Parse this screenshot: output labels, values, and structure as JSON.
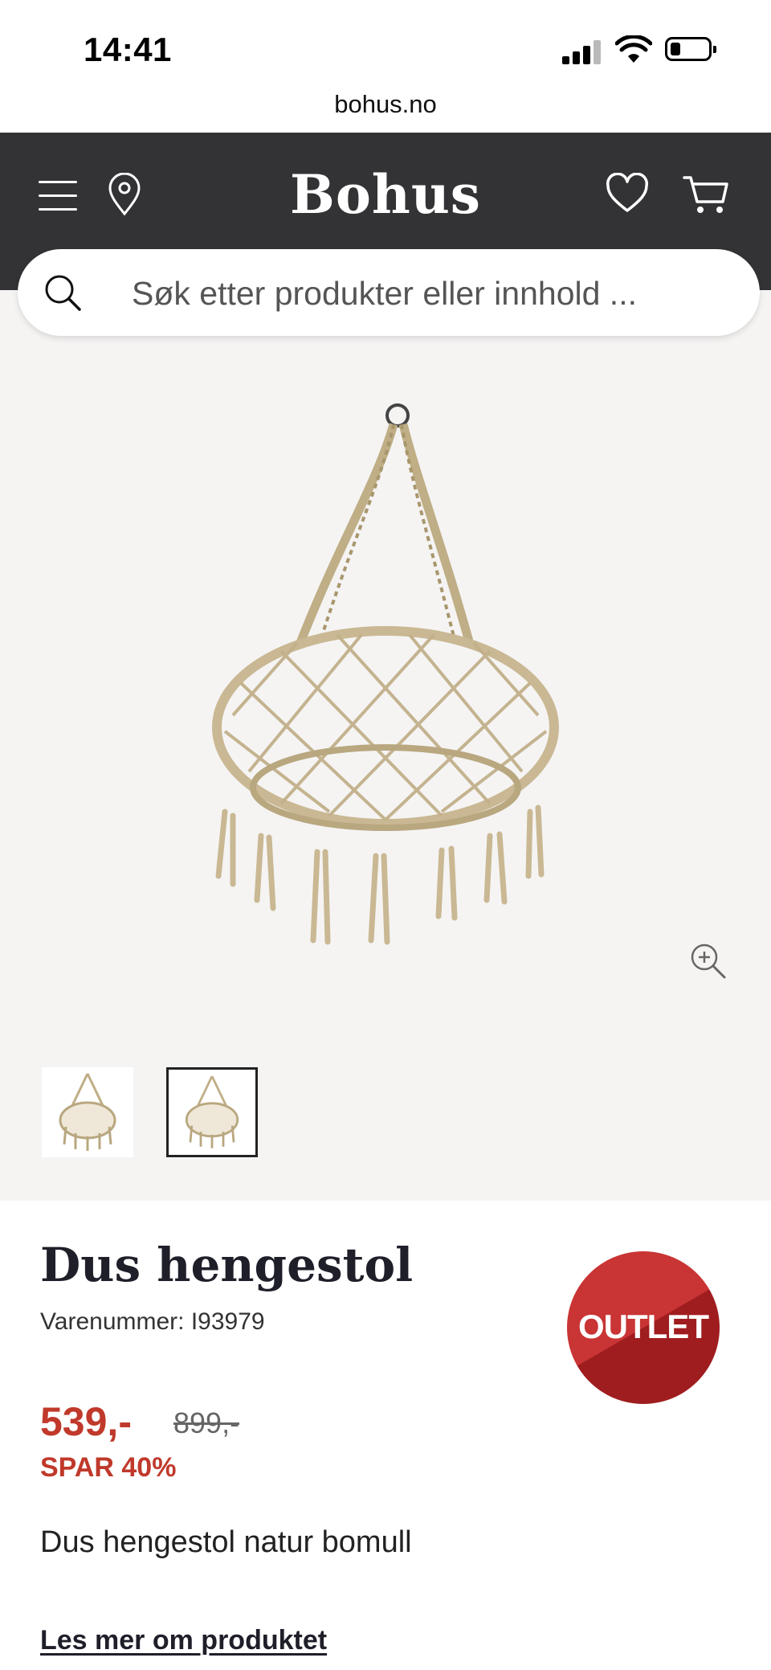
{
  "status_bar": {
    "time": "14:41"
  },
  "browser": {
    "url": "bohus.no"
  },
  "header": {
    "logo": "Bohus"
  },
  "search": {
    "placeholder": "Søk etter produkter eller innhold ..."
  },
  "icons": {
    "menu": "hamburger-menu-icon",
    "store_locator": "location-pin-icon",
    "wishlist": "heart-icon",
    "cart": "shopping-cart-icon",
    "search": "search-icon",
    "zoom": "zoom-in-icon"
  },
  "gallery": {
    "thumbnail_count": 2,
    "selected_index": 1
  },
  "product": {
    "name": "Dus hengestol",
    "sku": "Varenummer: I93979",
    "badge": "OUTLET",
    "price": "539,-",
    "old_price": "899,-",
    "savings": "SPAR 40%",
    "description": "Dus hengestol natur bomull",
    "read_more": "Les mer om produktet"
  },
  "colors": {
    "header_bg": "#333336",
    "gallery_bg": "#f5f4f3",
    "sale_red": "#c0392b",
    "badge_light": "#c93434",
    "badge_dark": "#9f1d1f"
  }
}
